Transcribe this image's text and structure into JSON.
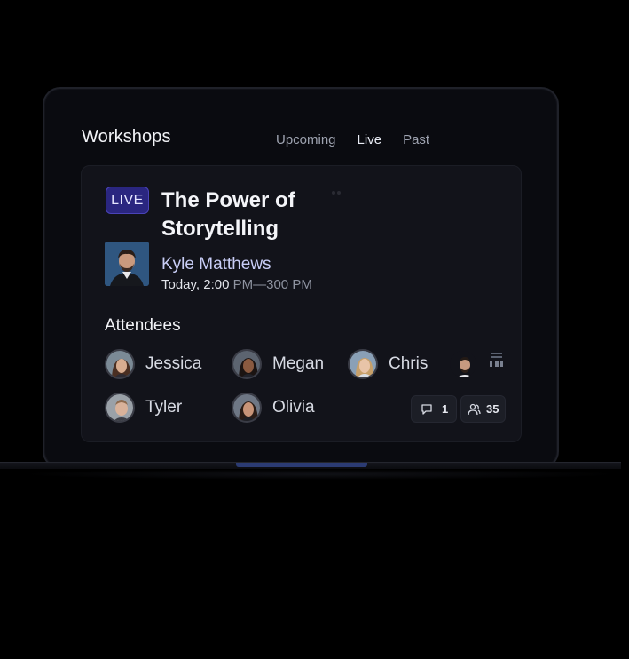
{
  "header": {
    "title": "Workshops"
  },
  "tabs": [
    {
      "label": "Upcoming",
      "active": false
    },
    {
      "label": "Live",
      "active": true
    },
    {
      "label": "Past",
      "active": false
    }
  ],
  "session": {
    "badge": "LIVE",
    "title": "The Power of Storytelling",
    "host": {
      "name": "Kyle Matthews",
      "time_start": "Today, 2:00",
      "time_range": " PM—300 PM"
    }
  },
  "attendees": {
    "title": "Attendees",
    "people": [
      "Jessica",
      "Megan",
      "Chris",
      "Tyler",
      "Olivia"
    ]
  },
  "stats": {
    "comments": "1",
    "participants": "35"
  },
  "colors": {
    "accent": "#2a2680",
    "host_name": "#c8cdf6",
    "base_strip": "#2b3b73"
  }
}
